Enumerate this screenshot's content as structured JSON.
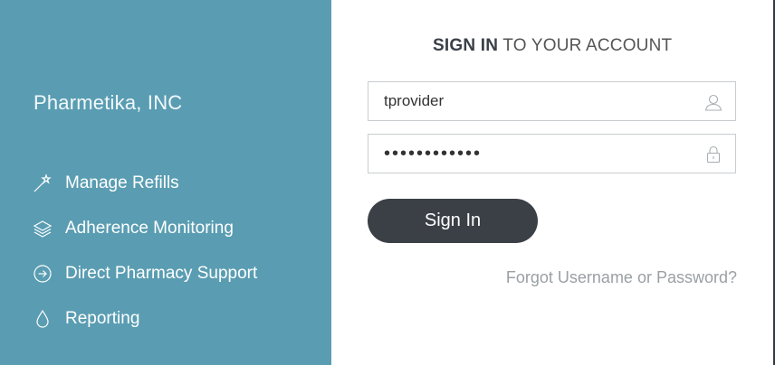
{
  "brand": {
    "company": "Pharmetika, INC"
  },
  "features": [
    {
      "label": "Manage Refills",
      "icon": "magic-wand-icon"
    },
    {
      "label": "Adherence Monitoring",
      "icon": "layers-icon"
    },
    {
      "label": "Direct Pharmacy Support",
      "icon": "arrow-circle-right-icon"
    },
    {
      "label": "Reporting",
      "icon": "drop-icon"
    }
  ],
  "login": {
    "heading_bold": "SIGN IN",
    "heading_rest": "TO YOUR ACCOUNT",
    "username_value": "tprovider",
    "username_icon": "user-icon",
    "password_value": "••••••••••••",
    "password_icon": "lock-icon",
    "signin_label": "Sign In",
    "forgot_label": "Forgot Username or Password?"
  },
  "colors": {
    "left_panel": "#5a9db2",
    "button": "#3b3f46",
    "muted_link": "#9aa0a5"
  }
}
